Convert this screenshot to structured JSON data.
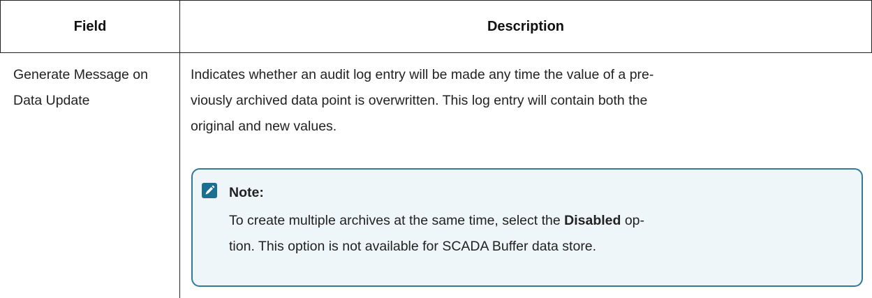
{
  "table": {
    "headers": {
      "field": "Field",
      "description": "Description"
    },
    "row": {
      "field_line1": "Generate Message on",
      "field_line2": "Data Update",
      "desc_line1": "Indicates whether an audit log entry will be made any time the value of a pre-",
      "desc_line2": "viously archived data point is overwritten. This log entry will contain both the",
      "desc_line3": "original and new values."
    }
  },
  "note": {
    "icon": "pencil-icon",
    "accent_color": "#1b6f92",
    "title": "Note:",
    "line1_before": "To create multiple archives at the same time, select the ",
    "line1_bold": "Disabled",
    "line1_after": " op-",
    "line2": "tion. This option is not available for SCADA Buffer data store."
  }
}
